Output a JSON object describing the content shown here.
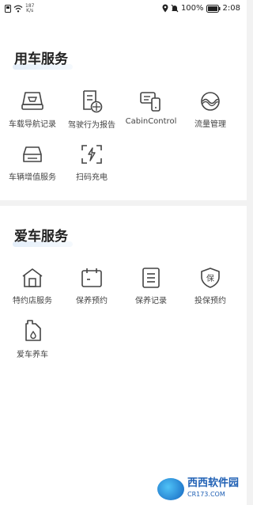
{
  "status_bar": {
    "speed_value": "187",
    "speed_unit": "K/s",
    "battery": "100%",
    "time": "2:08"
  },
  "section1": {
    "title": "用车服务",
    "items": [
      {
        "label": "车载导航记录",
        "icon": "car-navigation-record-icon"
      },
      {
        "label": "驾驶行为报告",
        "icon": "driving-report-icon"
      },
      {
        "label": "CabinControl",
        "icon": "cabin-control-icon"
      },
      {
        "label": "流量管理",
        "icon": "data-traffic-icon"
      },
      {
        "label": "车辆增值服务",
        "icon": "vehicle-value-added-icon"
      },
      {
        "label": "扫码充电",
        "icon": "scan-charge-icon"
      }
    ]
  },
  "section2": {
    "title": "爱车服务",
    "items": [
      {
        "label": "特约店服务",
        "icon": "dealer-store-icon"
      },
      {
        "label": "保养预约",
        "icon": "maintenance-booking-icon"
      },
      {
        "label": "保养记录",
        "icon": "maintenance-record-icon"
      },
      {
        "label": "投保预约",
        "icon": "insurance-booking-icon"
      },
      {
        "label": "爱车养车",
        "icon": "car-care-icon"
      }
    ],
    "insurance_glyph": "保"
  },
  "watermark": {
    "brand": "西西软件园",
    "domain": "CR173.COM"
  }
}
